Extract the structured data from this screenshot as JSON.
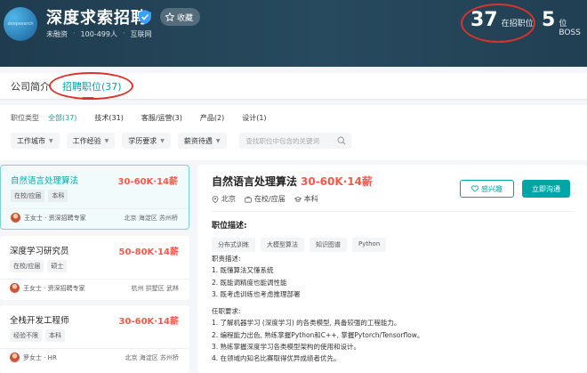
{
  "header": {
    "logo_text": "deepsearch",
    "company_name": "深度求索招聘",
    "favorite_label": "收藏",
    "meta": [
      "未融资",
      "100-499人",
      "互联网"
    ],
    "jobs_count": "37",
    "jobs_label": "在招职位",
    "boss_count": "5",
    "boss_label": "位BOSS",
    "accent": "#00a6a7",
    "salary_color": "#fe574a",
    "annotation_color": "#d9342b"
  },
  "tabs": {
    "intro": "公司简介",
    "jobs": "招聘职位(37)"
  },
  "filters": {
    "category_label": "职位类型",
    "categories": [
      "全部(37)",
      "技术(31)",
      "客服/运营(3)",
      "产品(2)",
      "设计(1)"
    ],
    "dropdowns": [
      "工作城市",
      "工作经验",
      "学历要求",
      "薪资待遇"
    ],
    "search_placeholder": "查找职位中包含的关键词"
  },
  "jobs": [
    {
      "title": "自然语言处理算法",
      "salary": "30-60K·14薪",
      "tags": [
        "在校/应届",
        "本科"
      ],
      "recruiter": "王女士 · 资深招聘专家",
      "location": "北京  海淀区  苏州桥"
    },
    {
      "title": "深度学习研究员",
      "salary": "50-80K·14薪",
      "tags": [
        "在校/应届",
        "硕士"
      ],
      "recruiter": "王女士 · 资深招聘专家",
      "location": "杭州  拱墅区  武林"
    },
    {
      "title": "全栈开发工程师",
      "salary": "30-60K·14薪",
      "tags": [
        "经验不限",
        "本科"
      ],
      "recruiter": "罗女士 · HR",
      "location": "北京  海淀区  苏州桥"
    }
  ],
  "detail": {
    "title": "自然语言处理算法",
    "salary": "30-60K·14薪",
    "city": "北京",
    "experience": "在校/应届",
    "degree": "本科",
    "interest_label": "感兴趣",
    "chat_label": "立即沟通",
    "section_title": "职位描述:",
    "skills": [
      "分布式训练",
      "大模型算法",
      "知识图谱",
      "Python"
    ],
    "lines": [
      "职责描述:",
      "1. 既懂算法又懂系统",
      "2. 既能调精度也能调性能",
      "3. 既考虑训练也考虑推理部署",
      "",
      "任职要求:",
      "1. 了解机器学习 (深度学习) 的各类模型, 具备较强的工程能力。",
      "2. 编程能力出色, 熟练掌握Python和C++, 掌握Pytorch/Tensorflow。",
      "3. 熟练掌握深度学习各类模型架构的使用和设计。",
      "4. 在领域内知名比赛取得优异成绩者优先。"
    ]
  }
}
